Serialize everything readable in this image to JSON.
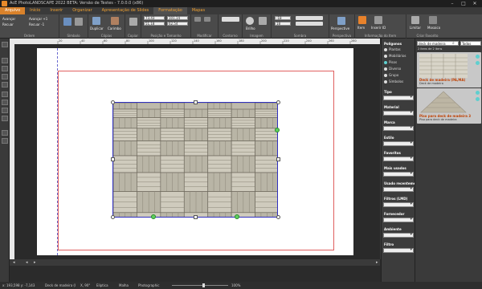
{
  "window": {
    "title": "AcE PhotoLANDSCAPE 2022 BETA: Versão de Testes - 7.0.0.0 (x86)"
  },
  "menu": [
    "Arquivo",
    "Início",
    "Inserir",
    "Organizar",
    "Apresentação de Slides",
    "Formatação",
    "Mapas"
  ],
  "ribbon": {
    "ordem": {
      "label": "Ordem",
      "forward": "Avançar",
      "back": "Recuar",
      "forward_one": "Avançar +1",
      "back_one": "Recuar -1"
    },
    "simbolo": {
      "label": "Símbolo"
    },
    "copias": {
      "label": "Cópias",
      "duplicate": "Duplicar",
      "carimbo": "Carimbo"
    },
    "copiar": {
      "label": "Copiar"
    },
    "posicao": {
      "label": "Posição e Tamanho",
      "x": "73,43",
      "y": "51,18",
      "w": "101,14",
      "h": "62,54"
    },
    "modificar": {
      "label": "Modificar"
    },
    "contorno": {
      "label": "Contorno"
    },
    "imagem": {
      "label": "Imagem",
      "brilho": "Brilho"
    },
    "sombra": {
      "label": "Sombra",
      "v1": "-18",
      "v2": "18"
    },
    "perspectiva": {
      "label": "Perspectiva",
      "btn": "Perspective"
    },
    "info": {
      "label": "Informação do Item",
      "item": "Item",
      "inserir": "Inserir ID"
    },
    "criar": {
      "label": "Criar Favorito",
      "limitar": "Limitar",
      "mosaico": "Mosaico"
    }
  },
  "rulers": {
    "top": [
      "20",
      "40",
      "60",
      "80",
      "100",
      "120",
      "140",
      "160",
      "180",
      "200",
      "220",
      "240",
      "260",
      "280"
    ]
  },
  "categories": {
    "header": "Polígonos",
    "radios": [
      "Plantas",
      "Mobiliários",
      "Pisos",
      "Diverso",
      "Grupo",
      "Símbolos"
    ],
    "filters": [
      "Tipo",
      "Material",
      "Marca",
      "Estilo",
      "Favoritos",
      "Mais usados",
      "Usado recentemente",
      "Filtros (LMD)",
      "Fornecedor",
      "Ambiente",
      "Filtro"
    ]
  },
  "resources": {
    "search_value": "deck de madeira",
    "scope": "Todos",
    "count": "2 itens de 2 itens",
    "items": [
      {
        "title": "Deck de madeira (PA,MA)",
        "sub": "Deck de madeira"
      },
      {
        "title": "Piso para deck de madeira 3",
        "sub": "Piso para deck de madeira"
      }
    ]
  },
  "status": {
    "coords": "x: 193,598  y: -7,143",
    "item": "Deck de madeira (l",
    "angle": "X, 90°",
    "eliptica": "Elíptica",
    "malha": "Malha",
    "mode": "Photographic",
    "zoom": "100%"
  },
  "colors": {
    "accent": "#d9822b",
    "selection": "#3030c0",
    "handle_green": "#5fcf5f",
    "frame_red": "#e06060"
  }
}
